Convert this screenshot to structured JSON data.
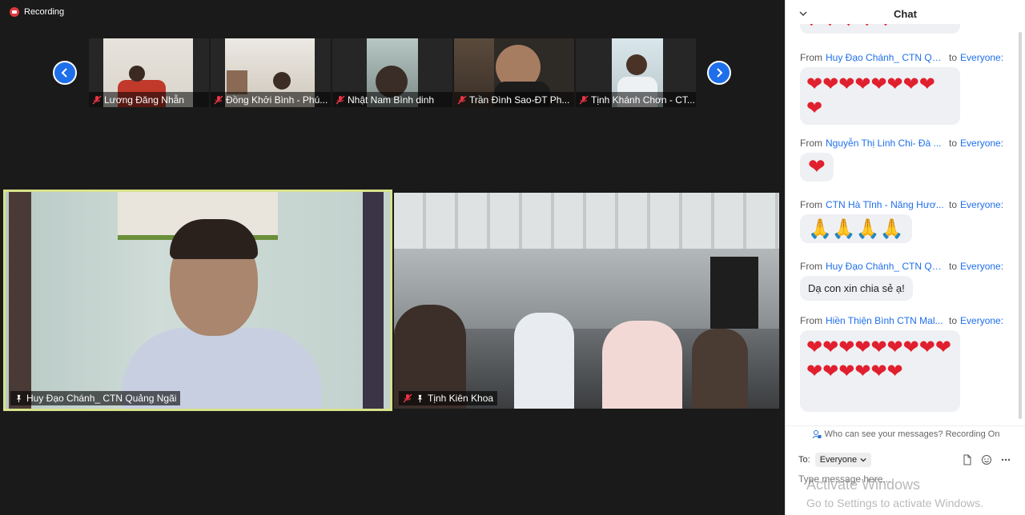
{
  "recording": {
    "label": "Recording"
  },
  "strip": {
    "participants": [
      {
        "name": "Lương Đăng Nhẫn"
      },
      {
        "name": "Đồng Khởi Bình - Phú..."
      },
      {
        "name": "Nhật Nam Bình dinh"
      },
      {
        "name": "Trần Đình Sao-ĐT Ph..."
      },
      {
        "name": "Tịnh Khánh Chơn - CT..."
      }
    ]
  },
  "main": {
    "speaker": {
      "name": "Huy Đạo Chánh_ CTN Quảng Ngãi"
    },
    "group": {
      "name": "Tịnh Kiên Khoa"
    }
  },
  "chat": {
    "title": "Chat",
    "messages": [
      {
        "from_label": "From",
        "sender": "Huy Đạo Chánh_ CTN Quả...",
        "to_label": "to",
        "recipient": "Everyone:",
        "content": "❤❤❤❤❤❤❤❤❤",
        "kind": "hearts"
      },
      {
        "from_label": "From",
        "sender": "Nguyễn Thị Linh Chi- Đà ...",
        "to_label": "to",
        "recipient": "Everyone:",
        "content": "❤",
        "kind": "hearts"
      },
      {
        "from_label": "From",
        "sender": "CTN Hà Tĩnh - Năng Hươ...",
        "to_label": "to",
        "recipient": "Everyone:",
        "content": "🙏🙏🙏🙏",
        "kind": "pray"
      },
      {
        "from_label": "From",
        "sender": "Huy Đạo Chánh_ CTN Quả...",
        "to_label": "to",
        "recipient": "Everyone:",
        "content": "Dạ con xin chia sẻ ạ!",
        "kind": "text"
      },
      {
        "from_label": "From",
        "sender": "Hiền Thiện Bình  CTN Mal...",
        "to_label": "to",
        "recipient": "Everyone:",
        "content": "❤❤❤❤❤❤❤❤❤❤❤❤❤❤❤",
        "kind": "hearts"
      }
    ],
    "privacy_text": "Who can see your messages? Recording On",
    "to_label": "To:",
    "to_value": "Everyone",
    "input_placeholder": "Type message here...",
    "watermark_line1": "Activate Windows",
    "watermark_line2": "Go to Settings to activate Windows."
  }
}
